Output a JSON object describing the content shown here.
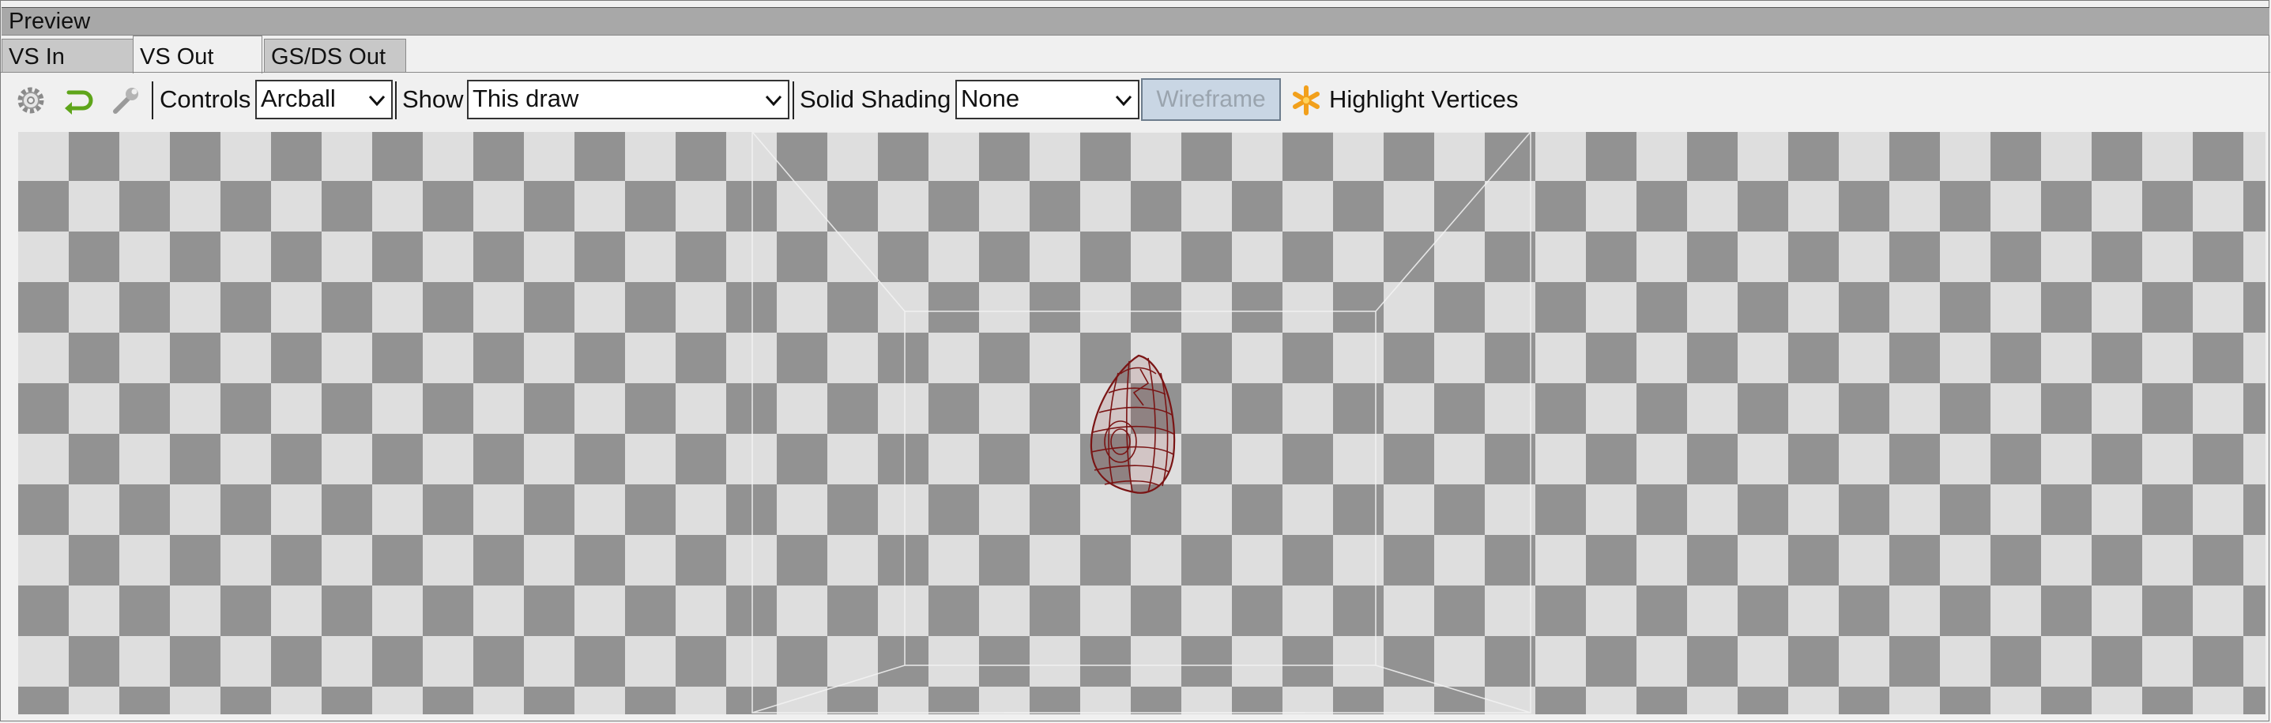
{
  "panel": {
    "title": "Preview"
  },
  "tabs": [
    {
      "label": "VS In"
    },
    {
      "label": "VS Out"
    },
    {
      "label": "GS/DS Out"
    }
  ],
  "toolbar": {
    "icons": [
      "gear-icon",
      "reset-arrow-icon",
      "wrench-icon",
      "highlight-asterisk-icon"
    ],
    "controls_label": "Controls",
    "controls_value": "Arcball",
    "show_label": "Show",
    "show_value": "This draw",
    "solid_shading_label": "Solid Shading",
    "solid_shading_value": "None",
    "wireframe_label": "Wireframe",
    "highlight_label": "Highlight Vertices"
  },
  "colors": {
    "checker_dark": "#929292",
    "checker_light": "#dedede",
    "mesh": "#7a1414",
    "wireframe_button_bg": "#c9d6e4",
    "reset_icon": "#5ea51a",
    "highlight_icon": "#f2a01c"
  }
}
